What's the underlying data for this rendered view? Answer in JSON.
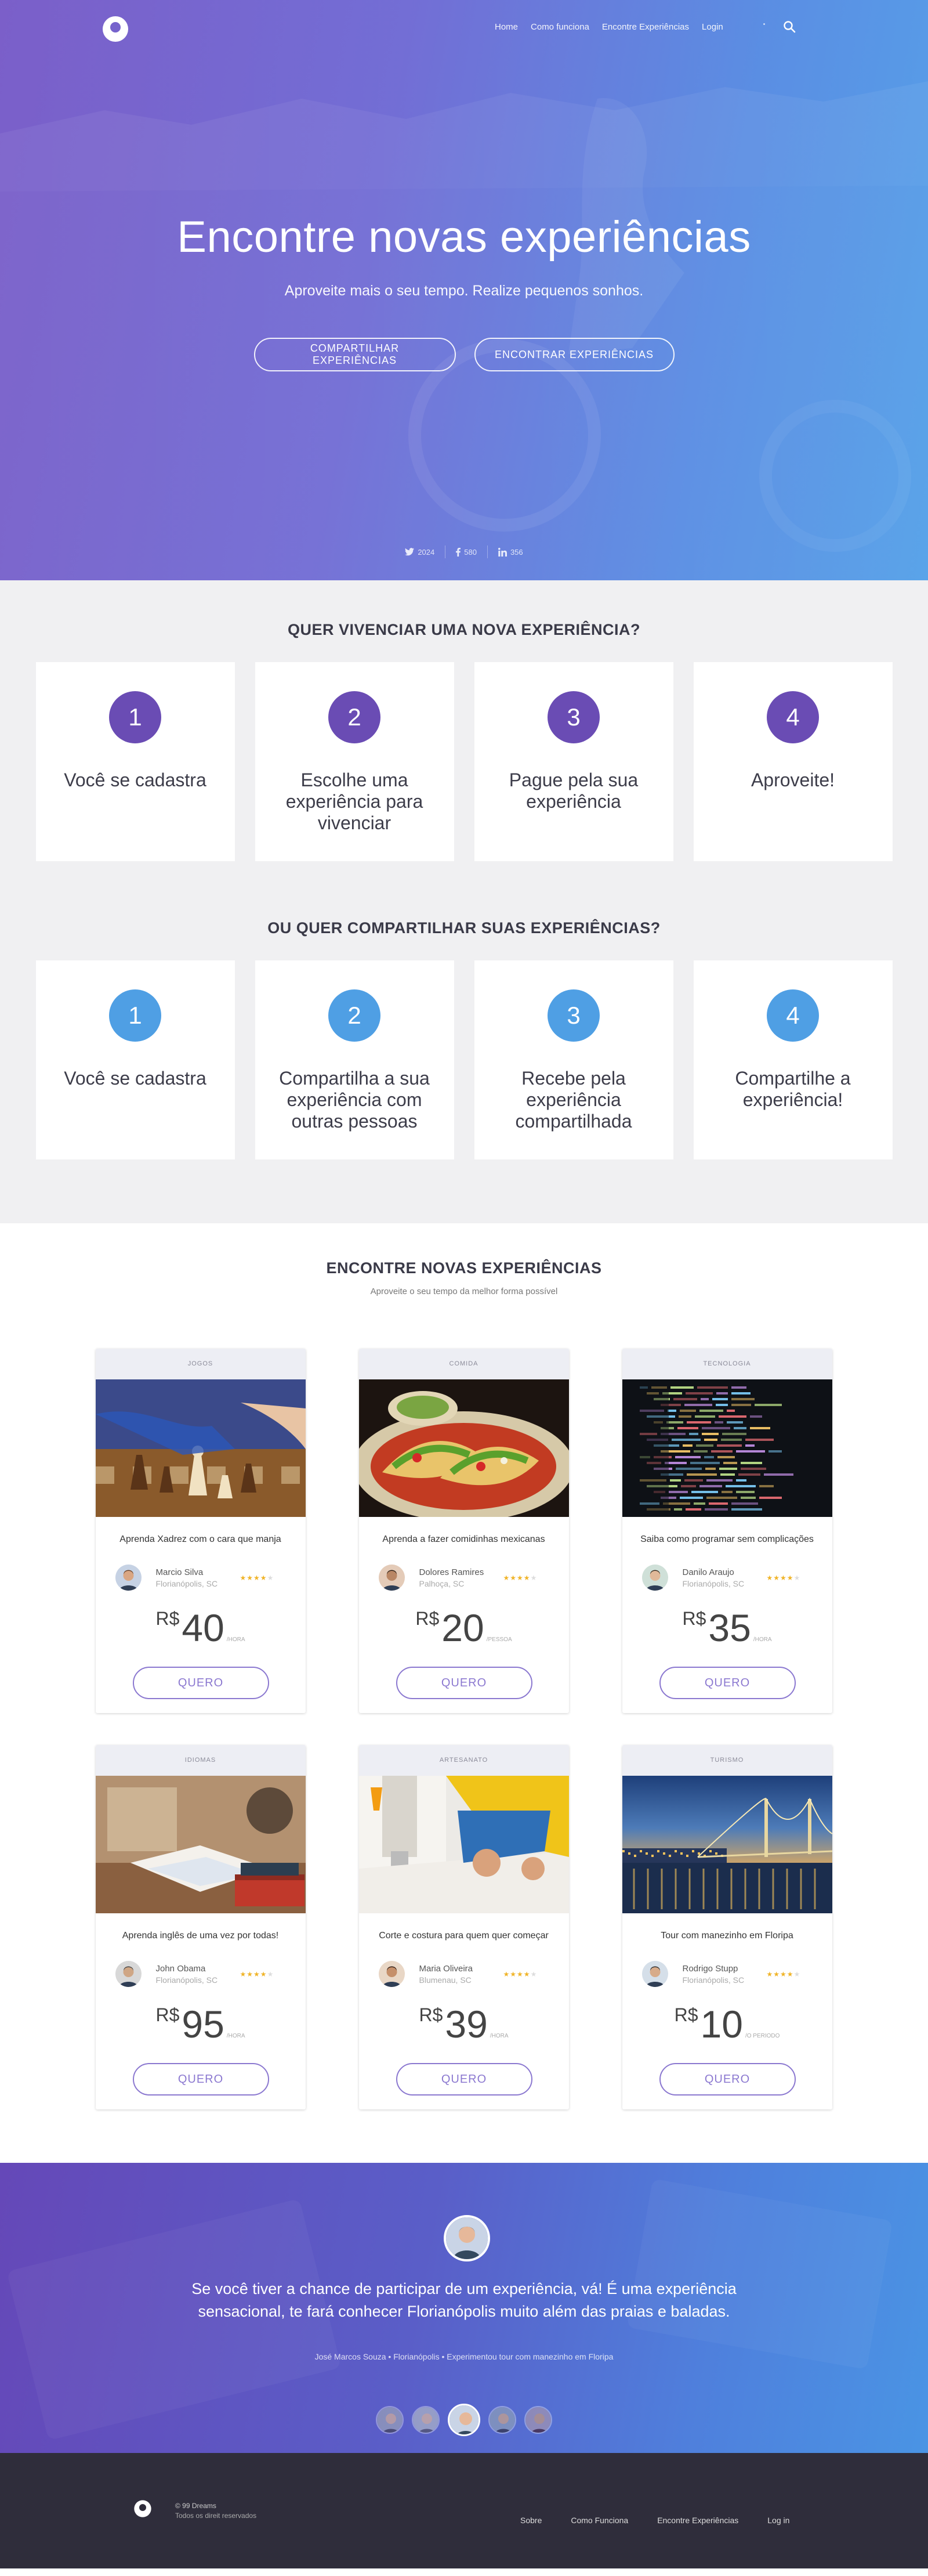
{
  "nav": {
    "links": [
      "Home",
      "Como funciona",
      "Encontre Experiências",
      "Login"
    ]
  },
  "hero": {
    "title": "Encontre novas experiências",
    "subtitle": "Aproveite mais o seu tempo. Realize pequenos sonhos.",
    "share_button": "COMPARTILHAR  EXPERIÊNCIAS",
    "find_button": "ENCONTRAR EXPERIÊNCIAS",
    "social": {
      "twitter": "2024",
      "facebook": "580",
      "linkedin": "356"
    }
  },
  "how_live": {
    "title": "QUER VIVENCIAR UMA NOVA EXPERIÊNCIA?",
    "steps": [
      {
        "num": "1",
        "text": "Você se cadastra"
      },
      {
        "num": "2",
        "text": "Escolhe uma experiência para vivenciar"
      },
      {
        "num": "3",
        "text": "Pague pela sua experiência"
      },
      {
        "num": "4",
        "text": "Aproveite!"
      }
    ]
  },
  "how_share": {
    "title": "OU QUER COMPARTILHAR SUAS EXPERIÊNCIAS?",
    "steps": [
      {
        "num": "1",
        "text": "Você se cadastra"
      },
      {
        "num": "2",
        "text": "Compartilha a sua experiência com outras pessoas"
      },
      {
        "num": "3",
        "text": "Recebe pela experiência compartilhada"
      },
      {
        "num": "4",
        "text": "Compartilhe a experiência!"
      }
    ]
  },
  "experiences": {
    "title": "ENCONTRE NOVAS EXPERIÊNCIAS",
    "subtitle": "Aproveite o seu tempo da melhor forma possível",
    "button_label": "QUERO",
    "cards": [
      {
        "category": "JOGOS",
        "name": "Aprenda Xadrez com o cara que manja",
        "host": "Marcio Silva",
        "city": "Florianópolis, SC",
        "rating": 4,
        "currency": "R$",
        "price": "40",
        "unit": "/HORA",
        "image": "chess"
      },
      {
        "category": "COMIDA",
        "name": "Aprenda a fazer comidinhas mexicanas",
        "host": "Dolores Ramires",
        "city": "Palhoça, SC",
        "rating": 4,
        "currency": "R$",
        "price": "20",
        "unit": "/PESSOA",
        "image": "tacos"
      },
      {
        "category": "TECNOLOGIA",
        "name": "Saiba como programar sem complicações",
        "host": "Danilo Araujo",
        "city": "Florianópolis, SC",
        "rating": 4,
        "currency": "R$",
        "price": "35",
        "unit": "/HORA",
        "image": "code"
      },
      {
        "category": "IDIOMAS",
        "name": "Aprenda inglês de uma vez por todas!",
        "host": "John Obama",
        "city": "Florianópolis, SC",
        "rating": 4,
        "currency": "R$",
        "price": "95",
        "unit": "/HORA",
        "image": "books"
      },
      {
        "category": "ARTESANATO",
        "name": "Corte e costura para quem quer começar",
        "host": "Maria Oliveira",
        "city": "Blumenau, SC",
        "rating": 4,
        "currency": "R$",
        "price": "39",
        "unit": "/HORA",
        "image": "sewing"
      },
      {
        "category": "TURISMO",
        "name": "Tour com manezinho em Floripa",
        "host": "Rodrigo Stupp",
        "city": "Florianópolis, SC",
        "rating": 4,
        "currency": "R$",
        "price": "10",
        "unit": "/O PERIODO",
        "image": "bridge"
      }
    ]
  },
  "testimonial": {
    "quote": "Se você tiver a chance de participar de um experiência, vá! É uma experiência sensacional, te fará conhecer Florianópolis muito além das praias e baladas.",
    "meta": "José Marcos Souza • Florianópolis • Experimentou tour com manezinho em Floripa"
  },
  "footer": {
    "copyright": "© 99 Dreams",
    "rights": "Todos os direit reservados",
    "links": [
      "Sobre",
      "Como Funciona",
      "Encontre Experiências",
      "Log in"
    ]
  },
  "colors": {
    "purple": "#6a4cb4",
    "blue": "#4f9fe4",
    "button_outline": "#8b78d0",
    "footer_bg": "#2f2d3b",
    "star": "#f0b429"
  }
}
